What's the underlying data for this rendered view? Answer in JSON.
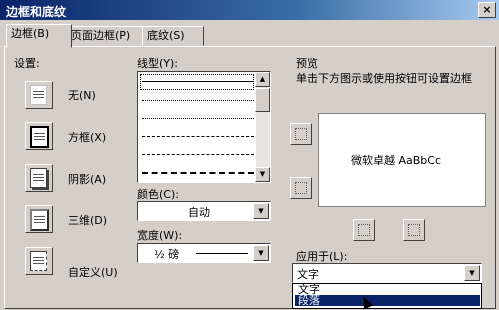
{
  "window": {
    "title": "边框和底纹",
    "close_label": "×"
  },
  "tabs": [
    {
      "label": "边框(B)"
    },
    {
      "label": "页面边框(P)"
    },
    {
      "label": "底纹(S)"
    }
  ],
  "settings": {
    "heading": "设置:",
    "items": [
      {
        "label": "无(N)"
      },
      {
        "label": "方框(X)"
      },
      {
        "label": "阴影(A)"
      },
      {
        "label": "三维(D)"
      },
      {
        "label": "自定义(U)"
      }
    ]
  },
  "style": {
    "heading": "线型(Y):",
    "lines": [
      "solid",
      "dotted",
      "dotted",
      "dashed",
      "dashed",
      "dashdot"
    ]
  },
  "color": {
    "label": "颜色(C):",
    "value": "自动"
  },
  "width": {
    "label": "宽度(W):",
    "value": "½ 磅"
  },
  "preview": {
    "heading": "预览",
    "instruction": "单击下方图示或使用按钮可设置边框",
    "sample_text": "微软卓越 AaBbCc"
  },
  "apply_to": {
    "label": "应用于(L):",
    "value": "文字",
    "options": [
      "文字",
      "段落"
    ],
    "highlighted": "段落"
  },
  "icons": {
    "scroll_up": "▲",
    "scroll_down": "▼",
    "dropdown": "▼"
  }
}
